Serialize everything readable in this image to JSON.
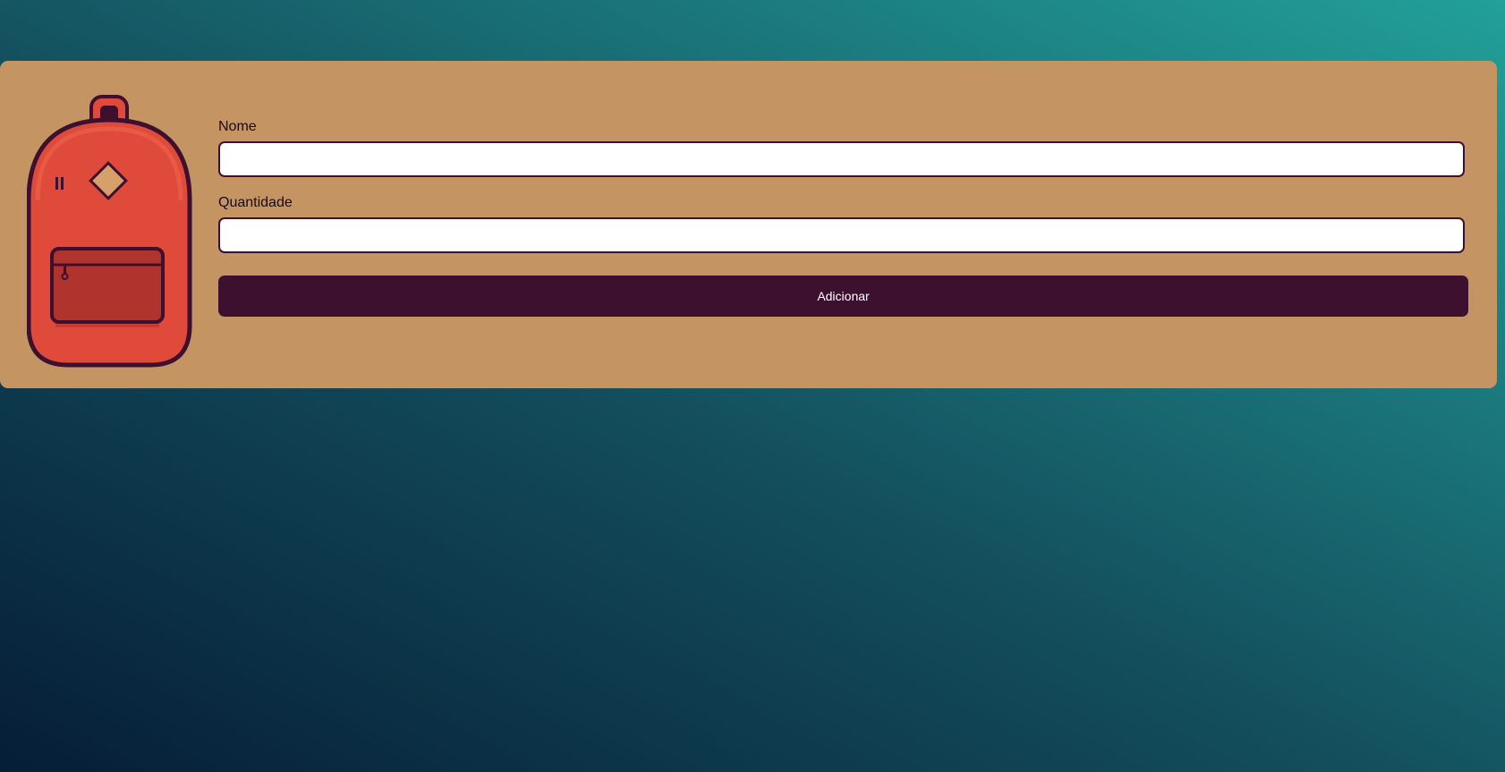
{
  "colors": {
    "panel": "#c49563",
    "accent": "#3e1030",
    "backpack": "#df4a3a",
    "pocket": "#b0332d",
    "background_start": "#061d36",
    "background_end": "#22a09a"
  },
  "illustration": {
    "icon": "backpack-icon"
  },
  "form": {
    "nome": {
      "label": "Nome",
      "value": "",
      "placeholder": ""
    },
    "quantidade": {
      "label": "Quantidade",
      "value": "",
      "placeholder": ""
    },
    "submit_label": "Adicionar"
  }
}
